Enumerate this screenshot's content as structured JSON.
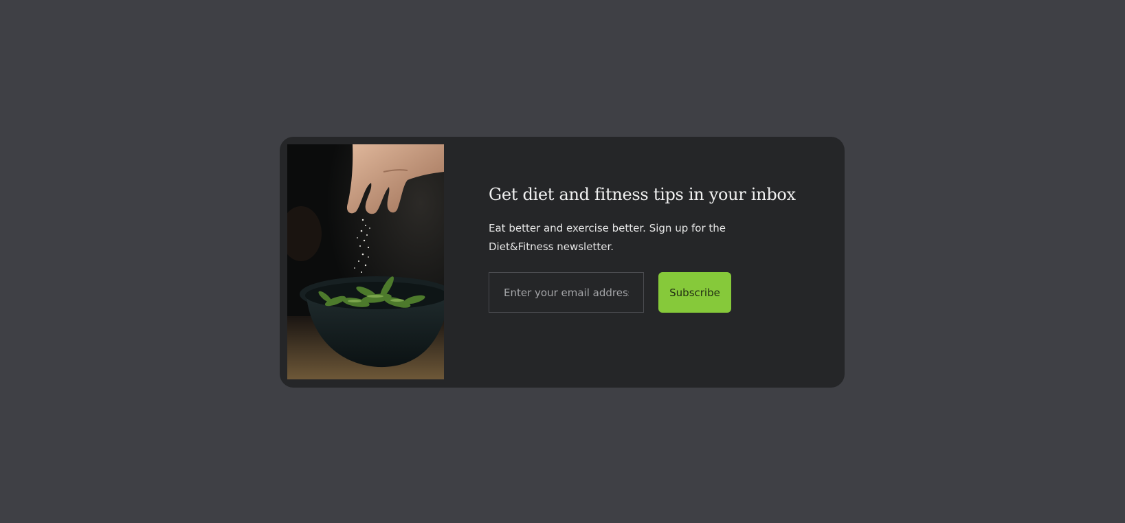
{
  "newsletter": {
    "title": "Get diet and fitness tips in your inbox",
    "description": "Eat better and exercise better. Sign up for the Diet&Fitness newsletter.",
    "email_placeholder": "Enter your email address",
    "email_value": "",
    "subscribe_label": "Subscribe"
  },
  "colors": {
    "page_background": "#3f4045",
    "card_background": "#252628",
    "accent": "#86c93a"
  }
}
